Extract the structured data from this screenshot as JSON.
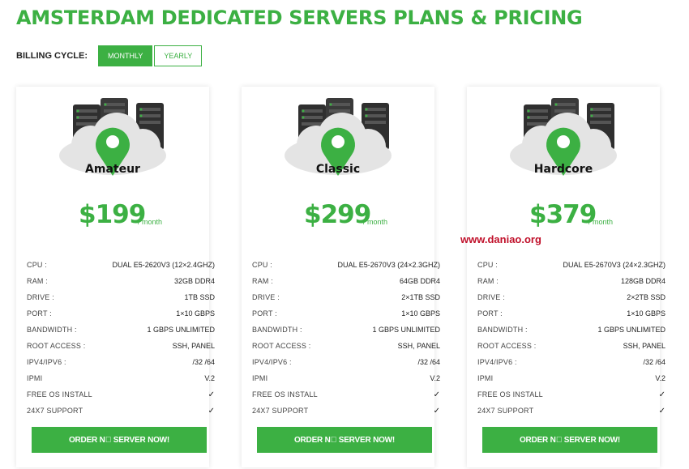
{
  "header": {
    "title": "AMSTERDAM DEDICATED SERVERS PLANS & PRICING",
    "billing_label": "BILLING CYCLE:",
    "billing_options": [
      "MONTHLY",
      "YEARLY"
    ],
    "billing_selected": "MONTHLY"
  },
  "colors": {
    "accent": "#3cb043",
    "watermark": "#c0102a"
  },
  "plans": [
    {
      "name": "Amateur",
      "price": "$199",
      "period": "/ month",
      "specs": [
        {
          "label": "CPU :",
          "value": "DUAL E5-2620V3 (12×2.4GHZ)"
        },
        {
          "label": "RAM :",
          "value": "32GB DDR4"
        },
        {
          "label": "DRIVE :",
          "value": "1TB SSD"
        },
        {
          "label": "PORT :",
          "value": "1×10 GBPS"
        },
        {
          "label": "BANDWIDTH :",
          "value": "1 GBPS UNLIMITED"
        },
        {
          "label": "ROOT ACCESS :",
          "value": "SSH, PANEL"
        },
        {
          "label": "IPV4/IPV6 :",
          "value": "/32 /64"
        },
        {
          "label": "IPMI",
          "value": "V.2"
        },
        {
          "label": "FREE OS INSTALL",
          "value": "✓"
        },
        {
          "label": "24X7 SUPPORT",
          "value": "✓"
        }
      ],
      "button": "ORDER N⃞ SERVER NOW!"
    },
    {
      "name": "Classic",
      "price": "$299",
      "period": "/ month",
      "specs": [
        {
          "label": "CPU :",
          "value": "DUAL E5-2670V3 (24×2.3GHZ)"
        },
        {
          "label": "RAM :",
          "value": "64GB DDR4"
        },
        {
          "label": "DRIVE :",
          "value": "2×1TB SSD"
        },
        {
          "label": "PORT :",
          "value": "1×10 GBPS"
        },
        {
          "label": "BANDWIDTH :",
          "value": "1 GBPS UNLIMITED"
        },
        {
          "label": "ROOT ACCESS :",
          "value": "SSH, PANEL"
        },
        {
          "label": "IPV4/IPV6 :",
          "value": "/32 /64"
        },
        {
          "label": "IPMI",
          "value": "V.2"
        },
        {
          "label": "FREE OS INSTALL",
          "value": "✓"
        },
        {
          "label": "24X7 SUPPORT",
          "value": "✓"
        }
      ],
      "button": "ORDER N⃞ SERVER NOW!"
    },
    {
      "name": "Hardcore",
      "price": "$379",
      "period": "/ month",
      "specs": [
        {
          "label": "CPU :",
          "value": "DUAL E5-2670V3 (24×2.3GHZ)"
        },
        {
          "label": "RAM :",
          "value": "128GB DDR4"
        },
        {
          "label": "DRIVE :",
          "value": "2×2TB SSD"
        },
        {
          "label": "PORT :",
          "value": "1×10 GBPS"
        },
        {
          "label": "BANDWIDTH :",
          "value": "1 GBPS UNLIMITED"
        },
        {
          "label": "ROOT ACCESS :",
          "value": "SSH, PANEL"
        },
        {
          "label": "IPV4/IPV6 :",
          "value": "/32 /64"
        },
        {
          "label": "IPMI",
          "value": "V.2"
        },
        {
          "label": "FREE OS INSTALL",
          "value": "✓"
        },
        {
          "label": "24X7 SUPPORT",
          "value": "✓"
        }
      ],
      "button": "ORDER N⃞ SERVER NOW!"
    }
  ],
  "watermark": "www.daniao.org"
}
